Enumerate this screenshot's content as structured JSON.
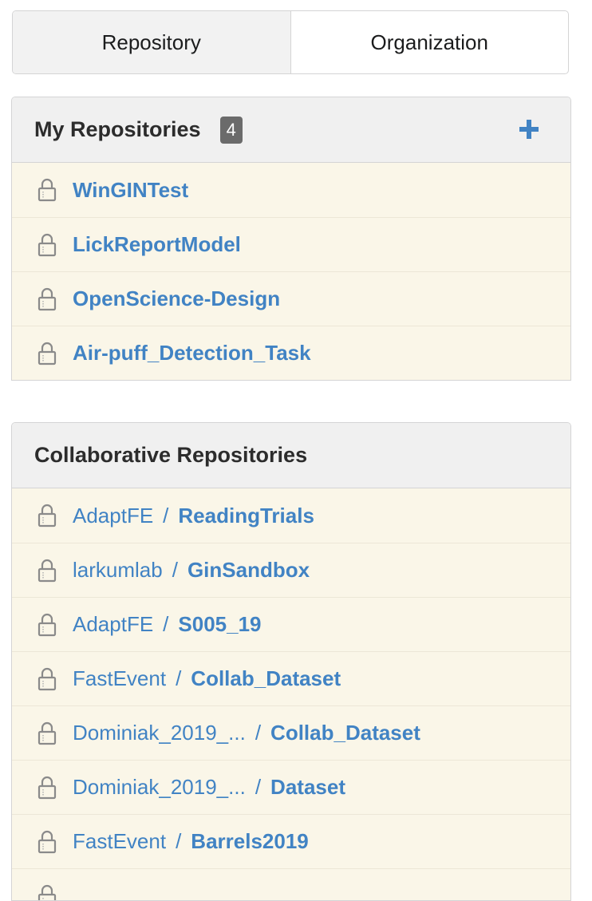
{
  "tabs": [
    {
      "label": "Repository",
      "active": true
    },
    {
      "label": "Organization",
      "active": false
    }
  ],
  "my_repos": {
    "title": "My Repositories",
    "count": "4",
    "add_icon": "plus-icon",
    "items": [
      {
        "name": "WinGINTest"
      },
      {
        "name": "LickReportModel"
      },
      {
        "name": "OpenScience-Design"
      },
      {
        "name": "Air-puff_Detection_Task"
      }
    ]
  },
  "collab_repos": {
    "title": "Collaborative Repositories",
    "items": [
      {
        "owner": "AdaptFE",
        "sep": "/",
        "name": "ReadingTrials"
      },
      {
        "owner": "larkumlab",
        "sep": "/",
        "name": "GinSandbox"
      },
      {
        "owner": "AdaptFE",
        "sep": "/",
        "name": "S005_19"
      },
      {
        "owner": "FastEvent",
        "sep": "/",
        "name": "Collab_Dataset"
      },
      {
        "owner": "Dominiak_2019_...",
        "sep": "/",
        "name": "Collab_Dataset"
      },
      {
        "owner": "Dominiak_2019_...",
        "sep": "/",
        "name": "Dataset"
      },
      {
        "owner": "FastEvent",
        "sep": "/",
        "name": "Barrels2019"
      }
    ]
  },
  "colors": {
    "link": "#4183c4",
    "row_bg": "#faf6e8",
    "header_bg": "#f0f0f0"
  }
}
